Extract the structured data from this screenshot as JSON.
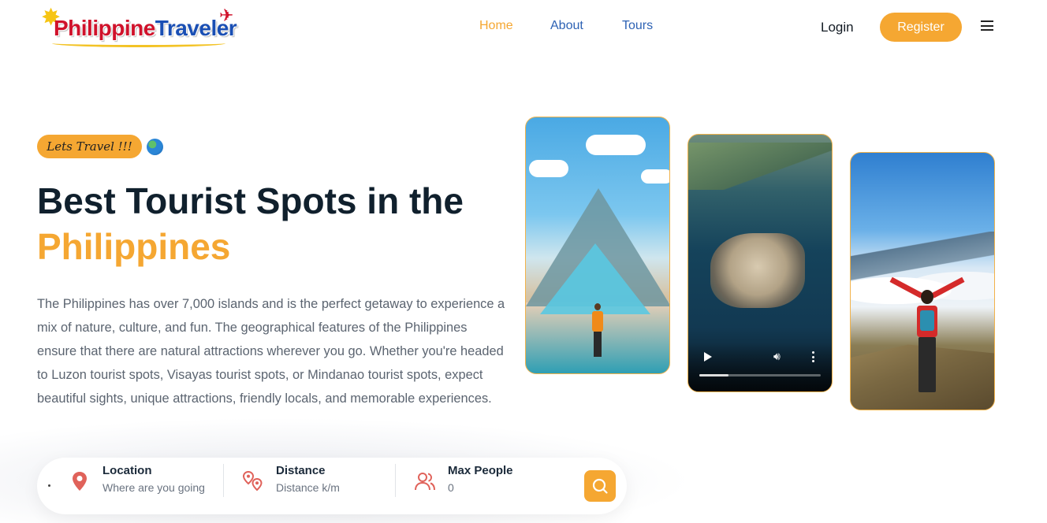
{
  "header": {
    "logo_text_part1": "Philippine",
    "logo_text_part2": "Traveler",
    "nav": {
      "home": "Home",
      "about": "About",
      "tours": "Tours"
    },
    "login": "Login",
    "register": "Register"
  },
  "hero": {
    "tag": "Lets Travel !!!",
    "title_line1": "Best Tourist Spots in the",
    "title_line2": "Philippines",
    "description": "The Philippines has over 7,000 islands and is the perfect getaway to experience a mix of nature, culture, and fun. The geographical features of the Philippines ensure that there are natural attractions wherever you go. Whether you're headed to Luzon tourist spots, Visayas tourist spots, or Mindanao tourist spots, expect beautiful sights, unique attractions, friendly locals, and memorable experiences."
  },
  "video": {
    "progress": 0.24
  },
  "search": {
    "location_label": "Location",
    "location_value": "Where are you going",
    "distance_label": "Distance",
    "distance_value": "Distance k/m",
    "people_label": "Max People",
    "people_value": "0"
  },
  "colors": {
    "accent": "#f5a732",
    "nav_link": "#2d62b4",
    "heading": "#10202d",
    "icon_red": "#e0625a"
  },
  "icons": {
    "menu": "hamburger-menu-icon",
    "globe": "globe-icon",
    "location": "map-pin-icon",
    "distance": "route-pins-icon",
    "people": "users-icon",
    "search": "search-icon",
    "play": "play-icon",
    "volume": "volume-icon",
    "more": "more-vertical-icon"
  }
}
